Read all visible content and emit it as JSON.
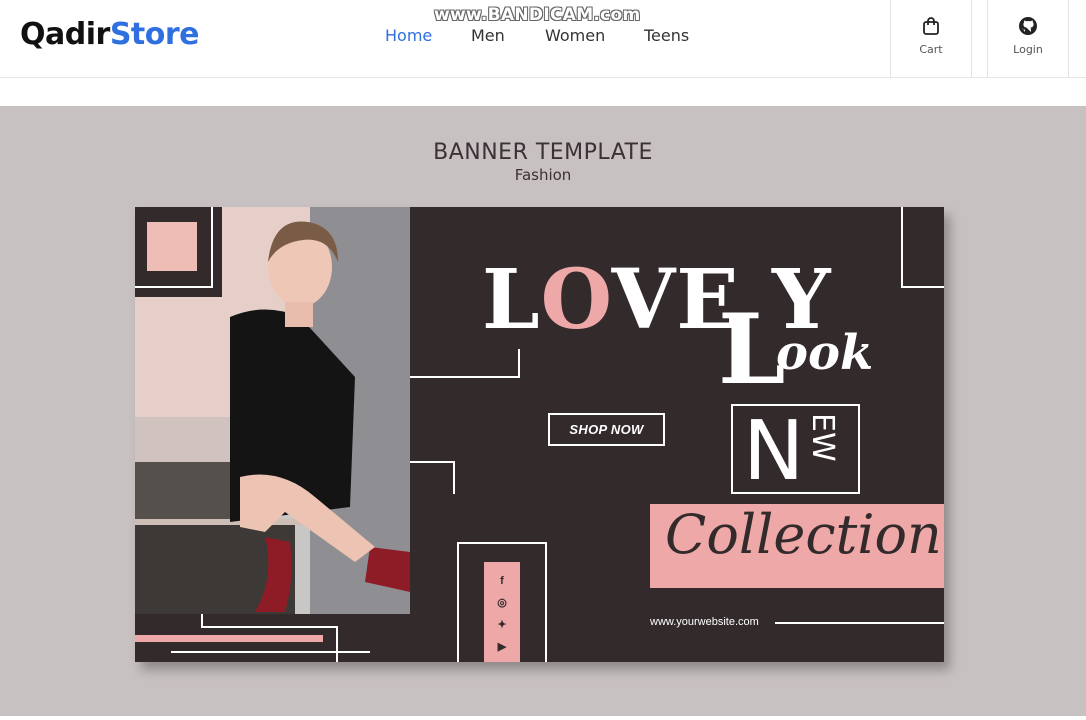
{
  "brand": {
    "part1": "Qadir",
    "part2": "Store"
  },
  "watermark": "www.BANDICAM.com",
  "nav": {
    "links": [
      {
        "label": "Home",
        "active": true
      },
      {
        "label": "Men",
        "active": false
      },
      {
        "label": "Women",
        "active": false
      },
      {
        "label": "Teens",
        "active": false
      }
    ],
    "cart_label": "Cart",
    "login_label": "Login"
  },
  "hero": {
    "title": "BANNER TEMPLATE",
    "subtitle": "Fashion",
    "background": "#c8c1c1"
  },
  "banner": {
    "word_lo": "L",
    "word_o": "O",
    "word_rest": "VE",
    "big_l": "L",
    "y_letter": "Y",
    "look_rest": "ook",
    "new_n": "N",
    "new_ew": "EW",
    "shop_now": "SHOP NOW",
    "collection": "Collection",
    "website": "www.yourwebsite.com",
    "social": [
      "facebook-icon",
      "instagram-icon",
      "twitter-icon",
      "youtube-icon"
    ],
    "colors": {
      "dark": "#332a2c",
      "pink": "#eea8a8",
      "accent": "#2f6fe0"
    }
  }
}
